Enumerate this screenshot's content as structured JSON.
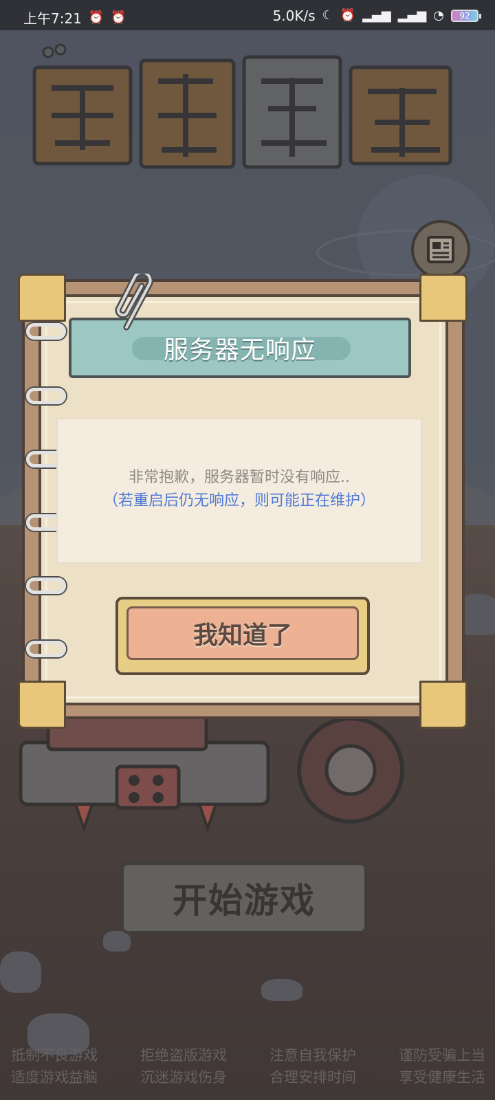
{
  "status_bar": {
    "time": "上午7:21",
    "network_speed": "5.0K/s",
    "battery_level": "92",
    "icons": [
      "alarm-icon",
      "alarm-icon",
      "moon-icon",
      "alarm-icon",
      "signal-icon",
      "signal-icon",
      "wifi-icon",
      "battery-icon"
    ]
  },
  "dialog": {
    "title": "服务器无响应",
    "message_line1": "非常抱歉，服务器暂时没有响应..",
    "message_line2": "（若重启后仍无响应，则可能正在维护）",
    "confirm_label": "我知道了"
  },
  "start_button_label": "开始游戏",
  "footer": {
    "row1": [
      "抵制不良游戏",
      "拒绝盗版游戏",
      "注意自我保护",
      "谨防受骗上当"
    ],
    "row2": [
      "适度游戏益脑",
      "沉迷游戏伤身",
      "合理安排时间",
      "享受健康生活"
    ]
  },
  "colors": {
    "title_plate": "#9cc7c3",
    "confirm_button": "#edb294",
    "message_highlight": "#4f7ad7",
    "paper": "#ece0c6"
  }
}
